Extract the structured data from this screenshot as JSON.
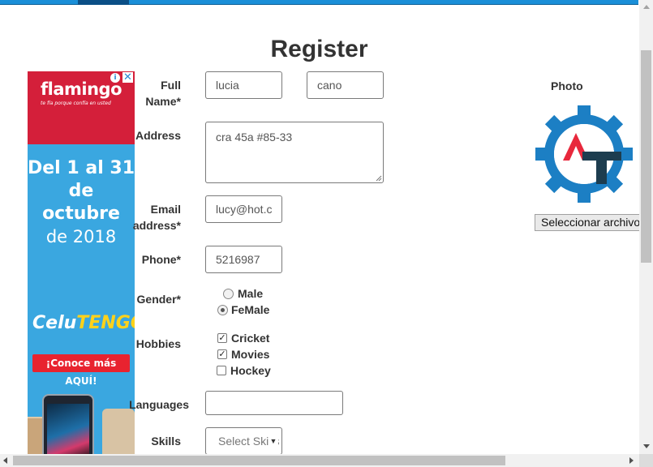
{
  "page": {
    "title": "Register"
  },
  "ad": {
    "brand": "flamingo",
    "tagline": "te fía porque confía en usted",
    "info_icon": "info-icon",
    "close_icon": "close-icon",
    "headline_line1": "Del 1 al 31",
    "headline_line2": "de octubre",
    "headline_line3": "de 2018",
    "promo_part1": "Celu",
    "promo_part2": "TENGO",
    "cta": "¡Conoce más AQUÍ!",
    "colors": {
      "red": "#d41f3a",
      "blue": "#3aa7e0",
      "yellow": "#ffd21a"
    }
  },
  "form": {
    "fullname": {
      "label_line1": "Full",
      "label_line2": "Name*",
      "first": "lucia",
      "last": "cano"
    },
    "address": {
      "label": "Address",
      "value": "cra 45a #85-33"
    },
    "email": {
      "label_line1": "Email",
      "label_line2": "address*",
      "value": "lucy@hot.c"
    },
    "phone": {
      "label": "Phone*",
      "value": "5216987"
    },
    "gender": {
      "label": "Gender*",
      "options": [
        {
          "label": "Male",
          "selected": false
        },
        {
          "label": "FeMale",
          "selected": true
        }
      ]
    },
    "hobbies": {
      "label": "Hobbies",
      "options": [
        {
          "label": "Cricket",
          "checked": true
        },
        {
          "label": "Movies",
          "checked": true
        },
        {
          "label": "Hockey",
          "checked": false
        }
      ]
    },
    "languages": {
      "label": "Languages",
      "value": ""
    },
    "skills": {
      "label": "Skills",
      "selected": "Select Skills"
    }
  },
  "photo": {
    "label": "Photo",
    "file_button": "Seleccionar archivo",
    "logo_icon": "gear-logo-icon",
    "logo_colors": {
      "gear": "#1c7fc4",
      "a": "#e8283c",
      "t": "#1d3d4f"
    }
  }
}
